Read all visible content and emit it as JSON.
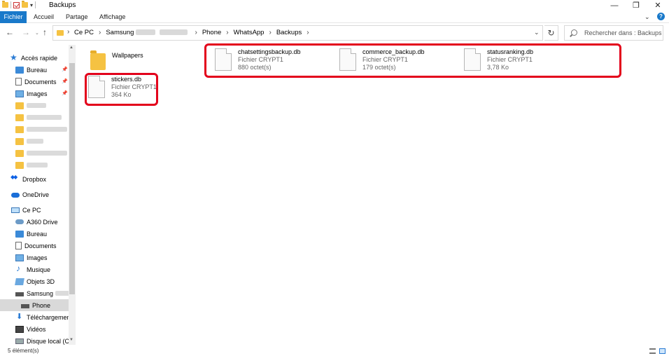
{
  "window": {
    "title": "Backups",
    "minimize_glyph": "—",
    "maximize_glyph": "❐",
    "close_glyph": "✕"
  },
  "ribbon": {
    "tabs": [
      "Fichier",
      "Accueil",
      "Partage",
      "Affichage"
    ],
    "expand_glyph": "⌄",
    "help_glyph": "?"
  },
  "navigation": {
    "back_glyph": "←",
    "forward_glyph": "→",
    "recent_glyph": "⌄",
    "up_glyph": "↑",
    "refresh_glyph": "↻"
  },
  "address": {
    "crumbs": [
      "Ce PC",
      "Samsung",
      "Phone",
      "WhatsApp",
      "Backups"
    ],
    "separator": "›",
    "dropdown_glyph": "⌄"
  },
  "search": {
    "placeholder": "Rechercher dans : Backups"
  },
  "sidebar": {
    "quick_access": "Accès rapide",
    "pinned": [
      "Bureau",
      "Documents",
      "Images"
    ],
    "blurred_folders_count": 5,
    "dropbox": "Dropbox",
    "onedrive": "OneDrive",
    "this_pc": "Ce PC",
    "pc_items": [
      "A360 Drive",
      "Bureau",
      "Documents",
      "Images",
      "Musique",
      "Objets 3D",
      "Samsung",
      "Phone",
      "Téléchargements",
      "Vidéos",
      "Disque local (C:)"
    ],
    "selected": "Phone"
  },
  "files": [
    {
      "name": "Wallpapers",
      "type": "",
      "size": "",
      "kind": "folder"
    },
    {
      "name": "chatsettingsbackup.db",
      "type": "Fichier CRYPT1",
      "size": "880 octet(s)",
      "kind": "file"
    },
    {
      "name": "commerce_backup.db",
      "type": "Fichier CRYPT1",
      "size": "179 octet(s)",
      "kind": "file"
    },
    {
      "name": "statusranking.db",
      "type": "Fichier CRYPT1",
      "size": "3,78 Ko",
      "kind": "file"
    },
    {
      "name": "stickers.db",
      "type": "Fichier CRYPT1",
      "size": "364 Ko",
      "kind": "file"
    }
  ],
  "status": {
    "count": "5 élément(s)"
  },
  "colors": {
    "accent": "#1979ca",
    "highlight": "#e3001b",
    "folder": "#f5c242"
  }
}
